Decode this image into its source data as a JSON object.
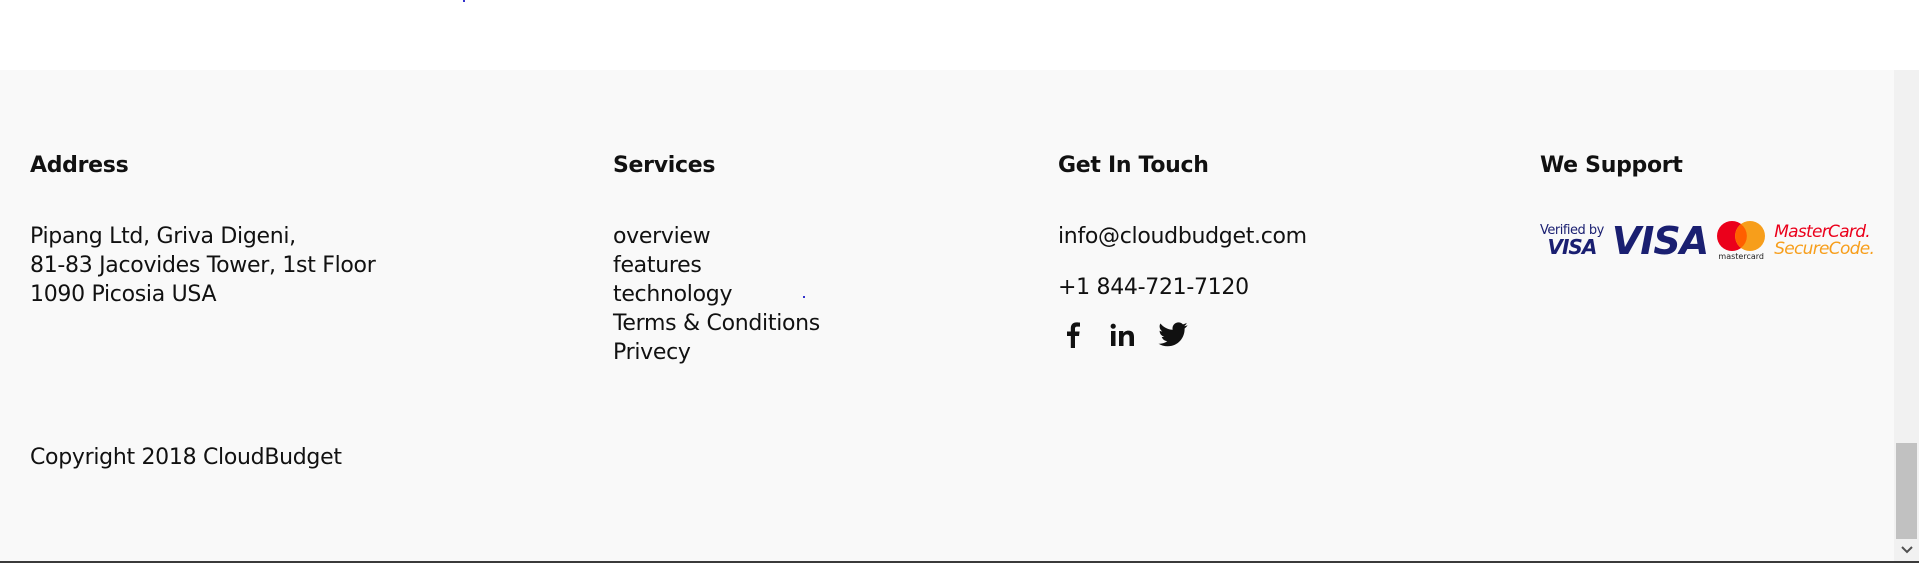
{
  "address": {
    "heading": "Address",
    "lines": [
      "Pipang Ltd, Griva Digeni,",
      "81-83 Jacovides Tower, 1st Floor",
      "1090 Picosia USA"
    ],
    "copyright": "Copyright 2018 CloudBudget"
  },
  "services": {
    "heading": "Services",
    "links": [
      "overview",
      "features",
      "technology",
      "Terms & Conditions",
      "Privecy"
    ]
  },
  "touch": {
    "heading": "Get In Touch",
    "email": "info@cloudbudget.com",
    "phone": "+1 844-721-7120",
    "social_icons": [
      "facebook-icon",
      "linkedin-icon",
      "twitter-icon"
    ]
  },
  "support": {
    "heading": "We Support",
    "logos": {
      "verified_line1": "Verified by",
      "verified_line2": "VISA",
      "visa": "VISA",
      "mastercard_small": "mastercard",
      "securecode_line1": "MasterCard.",
      "securecode_line2": "SecureCode."
    }
  },
  "colors": {
    "footer_bg": "#f9f9f9",
    "text": "#111111",
    "visa_blue": "#1a1f71",
    "mc_red": "#eb001b",
    "mc_orange": "#f79e1b"
  }
}
